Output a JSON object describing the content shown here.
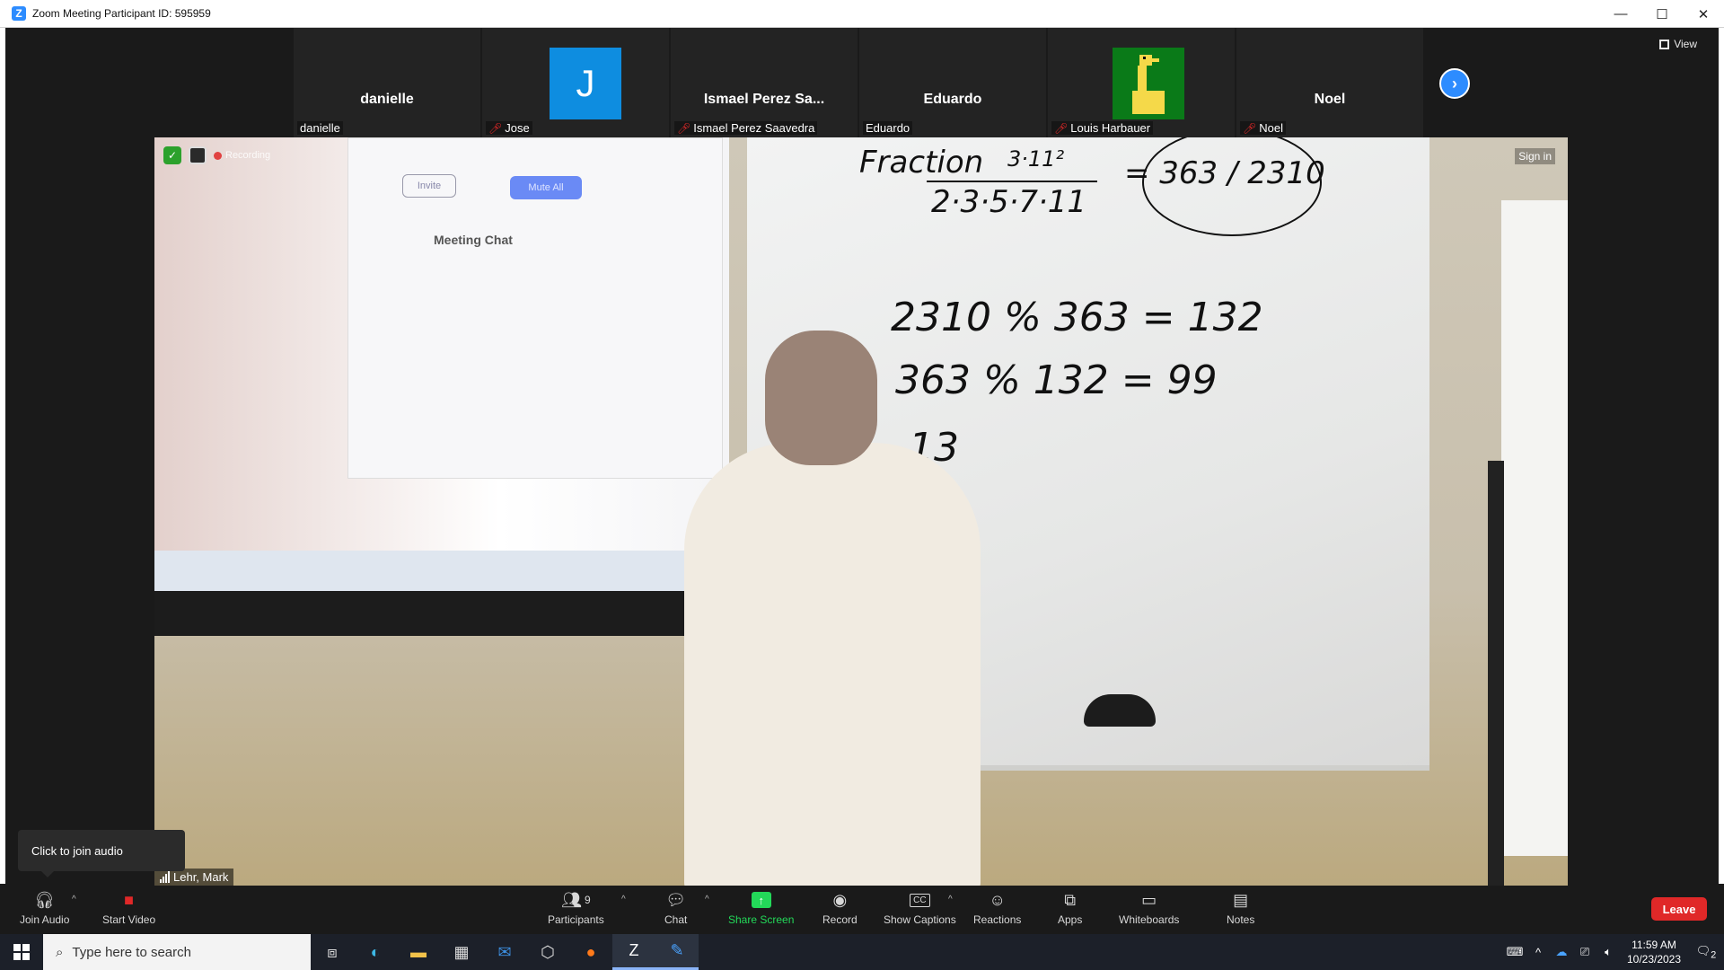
{
  "window": {
    "title": "Zoom Meeting Participant ID: 595959",
    "minimize": "—",
    "maximize": "☐",
    "close": "✕"
  },
  "view_button": {
    "label": "View"
  },
  "participants_strip": [
    {
      "big_name": "danielle",
      "label": "danielle",
      "muted": false,
      "avatar": "none"
    },
    {
      "big_name": "",
      "label": "Jose",
      "muted": true,
      "avatar": "letter",
      "letter": "J"
    },
    {
      "big_name": "Ismael Perez Sa...",
      "label": "Ismael Perez Saavedra",
      "muted": true,
      "avatar": "none"
    },
    {
      "big_name": "Eduardo",
      "label": "Eduardo",
      "muted": false,
      "avatar": "none"
    },
    {
      "big_name": "",
      "label": "Louis Harbauer",
      "muted": true,
      "avatar": "picture"
    },
    {
      "big_name": "Noel",
      "label": "Noel",
      "muted": true,
      "avatar": "none"
    }
  ],
  "main_video": {
    "recording_label": "Recording",
    "sign_in": "Sign in",
    "speaker_name": "Lehr, Mark",
    "screen_chat": {
      "title": "Meeting Chat",
      "invite": "Invite",
      "mute_all": "Mute All"
    },
    "board": {
      "line1_label": "Fraction",
      "line1_num": "3·11²",
      "line1_den": "2·3·5·7·11",
      "line1_eq": "= 363 / 2310",
      "line2": "2310 % 363 = 132",
      "line3": "363 % 132 = 99",
      "line4": "13"
    }
  },
  "tooltip": {
    "text": "Click to join audio"
  },
  "toolbar": {
    "join_audio": "Join Audio",
    "start_video": "Start Video",
    "participants": "Participants",
    "participants_count": "9",
    "chat": "Chat",
    "share_screen": "Share Screen",
    "record": "Record",
    "show_captions": "Show Captions",
    "reactions": "Reactions",
    "apps": "Apps",
    "whiteboards": "Whiteboards",
    "notes": "Notes",
    "leave": "Leave"
  },
  "taskbar": {
    "search_placeholder": "Type here to search",
    "time": "11:59 AM",
    "date": "10/23/2023",
    "notification_count": "2"
  },
  "colors": {
    "zoom_blue": "#2d8cff",
    "leave_red": "#e02828",
    "share_green": "#23d959",
    "muted_red": "#e02828"
  }
}
